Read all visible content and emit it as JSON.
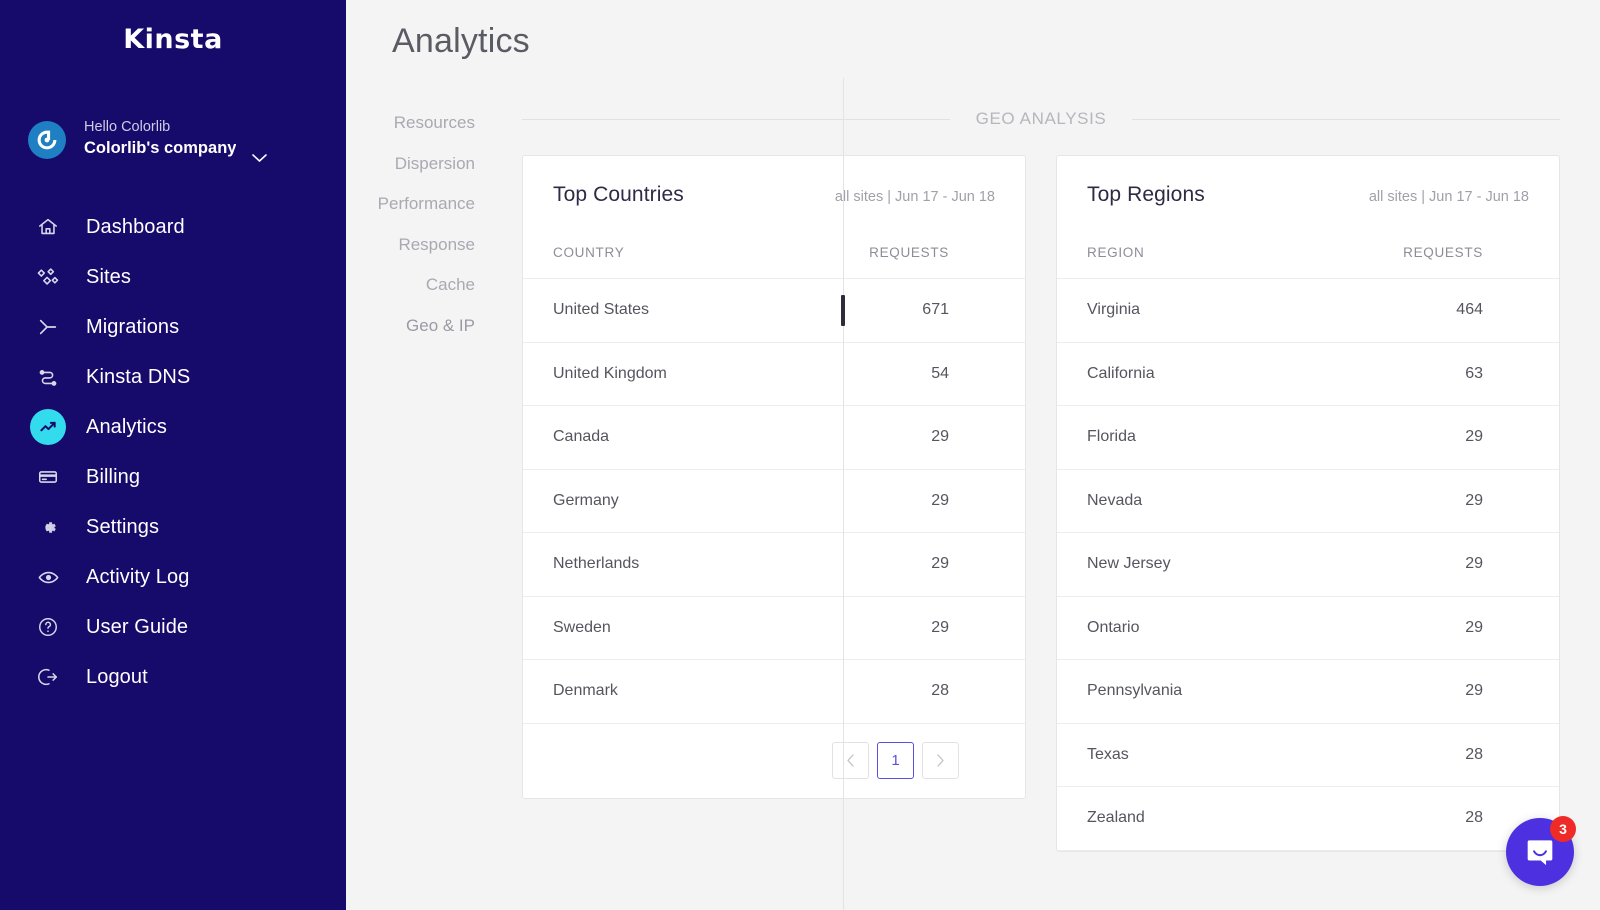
{
  "brand": {
    "logo_text": "Kinsta"
  },
  "account": {
    "hello": "Hello Colorlib",
    "company": "Colorlib's company",
    "caret_icon": "chevron-down-icon"
  },
  "sidebar": {
    "items": [
      {
        "label": "Dashboard",
        "icon": "home-icon",
        "active": false
      },
      {
        "label": "Sites",
        "icon": "sites-icon",
        "active": false
      },
      {
        "label": "Migrations",
        "icon": "migrations-icon",
        "active": false
      },
      {
        "label": "Kinsta DNS",
        "icon": "dns-icon",
        "active": false
      },
      {
        "label": "Analytics",
        "icon": "analytics-icon",
        "active": true
      },
      {
        "label": "Billing",
        "icon": "card-icon",
        "active": false
      },
      {
        "label": "Settings",
        "icon": "gear-icon",
        "active": false
      },
      {
        "label": "Activity Log",
        "icon": "eye-icon",
        "active": false
      },
      {
        "label": "User Guide",
        "icon": "question-circle-icon",
        "active": false
      },
      {
        "label": "Logout",
        "icon": "logout-icon",
        "active": false
      }
    ]
  },
  "header": {
    "title": "Analytics"
  },
  "subnav": {
    "items": [
      {
        "label": "Resources",
        "active": false
      },
      {
        "label": "Dispersion",
        "active": false
      },
      {
        "label": "Performance",
        "active": false
      },
      {
        "label": "Response",
        "active": false
      },
      {
        "label": "Cache",
        "active": false
      },
      {
        "label": "Geo & IP",
        "active": true
      }
    ]
  },
  "section": {
    "label": "GEO ANALYSIS"
  },
  "colors": {
    "sidebar_bg": "#160a6b",
    "accent_cyan": "#33dced",
    "accent_purple": "#5b4fe0",
    "intercom_purple": "#4d31e0",
    "badge_red": "#ef2b27",
    "page_bg": "#f4f4f5"
  },
  "countries_card": {
    "title": "Top Countries",
    "meta": "all sites | Jun 17 - Jun 18",
    "columns": [
      "COUNTRY",
      "REQUESTS"
    ],
    "rows": [
      {
        "name": "United States",
        "requests": "671"
      },
      {
        "name": "United Kingdom",
        "requests": "54"
      },
      {
        "name": "Canada",
        "requests": "29"
      },
      {
        "name": "Germany",
        "requests": "29"
      },
      {
        "name": "Netherlands",
        "requests": "29"
      },
      {
        "name": "Sweden",
        "requests": "29"
      },
      {
        "name": "Denmark",
        "requests": "28"
      }
    ],
    "pagination": {
      "prev_icon": "chevron-left-icon",
      "next_icon": "chevron-right-icon",
      "current_page": "1"
    }
  },
  "regions_card": {
    "title": "Top Regions",
    "meta": "all sites | Jun 17 - Jun 18",
    "columns": [
      "REGION",
      "REQUESTS"
    ],
    "rows": [
      {
        "name": "Virginia",
        "requests": "464"
      },
      {
        "name": "California",
        "requests": "63"
      },
      {
        "name": "Florida",
        "requests": "29"
      },
      {
        "name": "Nevada",
        "requests": "29"
      },
      {
        "name": "New Jersey",
        "requests": "29"
      },
      {
        "name": "Ontario",
        "requests": "29"
      },
      {
        "name": "Pennsylvania",
        "requests": "29"
      },
      {
        "name": "Texas",
        "requests": "28"
      },
      {
        "name": "Zealand",
        "requests": "28"
      }
    ]
  },
  "intercom": {
    "badge_count": "3",
    "icon": "chat-bubble-icon"
  }
}
